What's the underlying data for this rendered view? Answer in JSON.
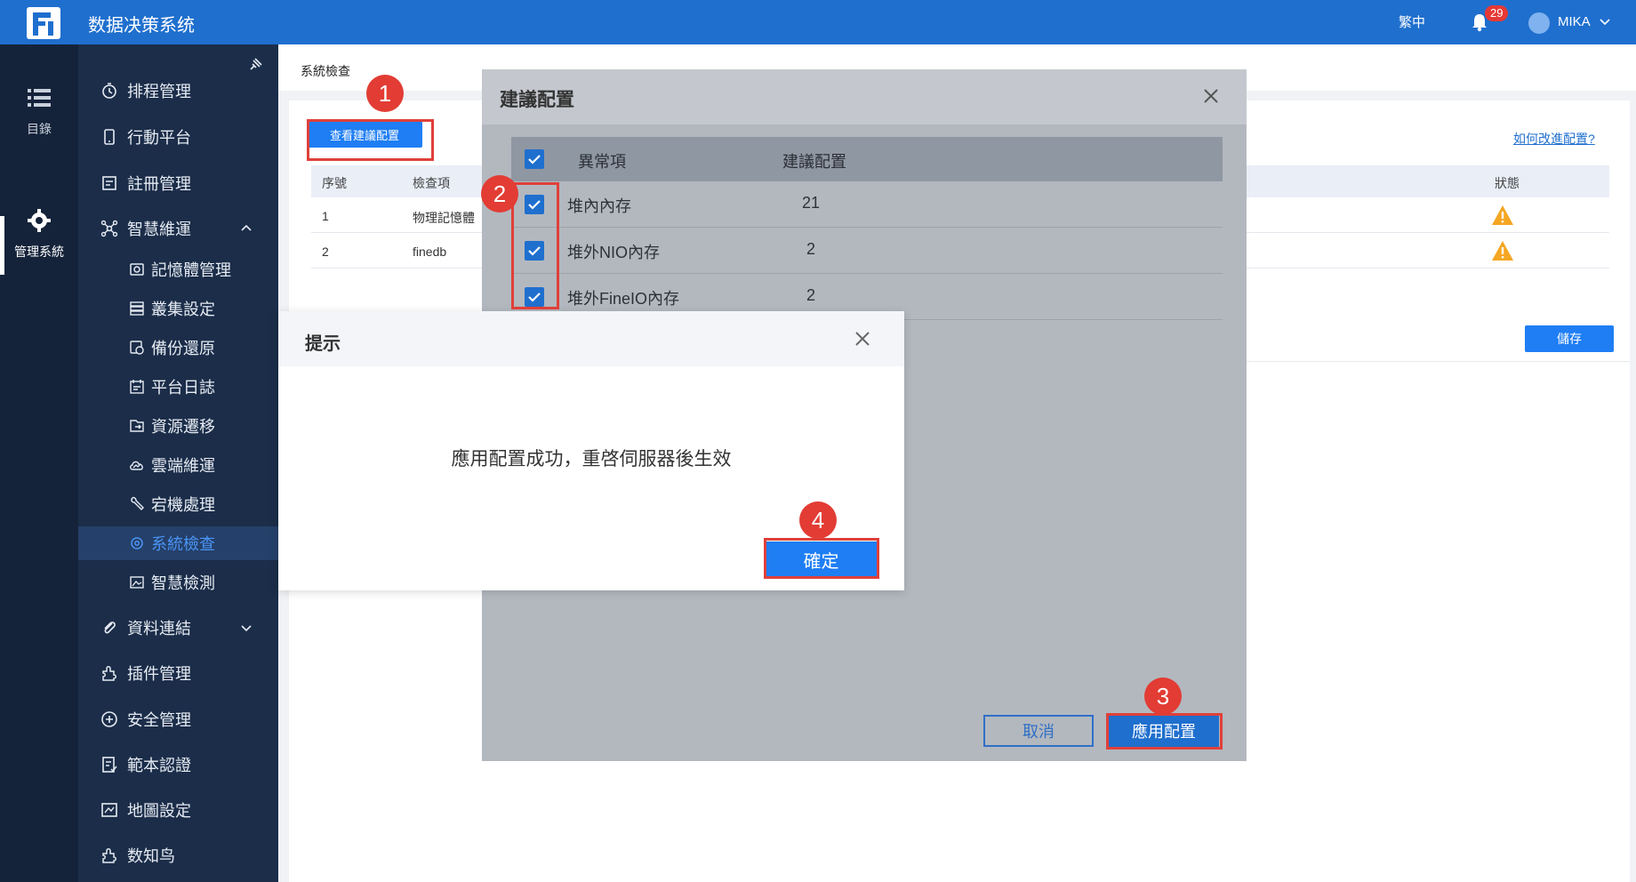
{
  "app": {
    "title": "数据决策系统",
    "lang": "繁中",
    "notifications": "29",
    "user": "MIKA"
  },
  "rail": {
    "items": [
      {
        "label": "目錄",
        "icon": "list-icon"
      },
      {
        "label": "管理系統",
        "icon": "gear-icon"
      }
    ]
  },
  "sidebar": {
    "items": [
      {
        "label": "排程管理",
        "icon": "timer-icon"
      },
      {
        "label": "行動平台",
        "icon": "mobile-icon"
      },
      {
        "label": "註冊管理",
        "icon": "register-icon"
      },
      {
        "label": "智慧維運",
        "icon": "network-icon"
      },
      {
        "label": "記憶體管理",
        "icon": "memory-icon"
      },
      {
        "label": "叢集設定",
        "icon": "cluster-icon"
      },
      {
        "label": "備份還原",
        "icon": "backup-icon"
      },
      {
        "label": "平台日誌",
        "icon": "log-icon"
      },
      {
        "label": "資源遷移",
        "icon": "migrate-icon"
      },
      {
        "label": "雲端維運",
        "icon": "cloud-icon"
      },
      {
        "label": "宕機處理",
        "icon": "wrench-icon"
      },
      {
        "label": "系統檢查",
        "icon": "gear-check-icon"
      },
      {
        "label": "智慧檢測",
        "icon": "image-check-icon"
      },
      {
        "label": "資料連結",
        "icon": "link-icon"
      },
      {
        "label": "插件管理",
        "icon": "plugin-icon"
      },
      {
        "label": "安全管理",
        "icon": "shield-icon"
      },
      {
        "label": "範本認證",
        "icon": "template-icon"
      },
      {
        "label": "地圖設定",
        "icon": "map-icon"
      },
      {
        "label": "数知鸟",
        "icon": "plugin-icon"
      }
    ]
  },
  "main": {
    "breadcrumb": "系統檢查",
    "view_button": "查看建議配置",
    "how_link": "如何改進配置?",
    "table": {
      "headers": [
        "序號",
        "檢查項",
        "狀態"
      ],
      "rows": [
        {
          "index": "1",
          "item": "物理記憶體"
        },
        {
          "index": "2",
          "item": "finedb"
        }
      ]
    },
    "save_button": "儲存"
  },
  "suggest_dialog": {
    "title": "建議配置",
    "headers": [
      "異常項",
      "建議配置"
    ],
    "rows": [
      {
        "item": "堆內內存",
        "value": "21"
      },
      {
        "item": "堆外NIO內存",
        "value": "2"
      },
      {
        "item": "堆外FineIO內存",
        "value": "2"
      }
    ],
    "cancel": "取消",
    "apply": "應用配置"
  },
  "prompt_dialog": {
    "title": "提示",
    "message": "應用配置成功，重啓伺服器後生效",
    "ok": "確定"
  },
  "annotations": [
    "1",
    "2",
    "3",
    "4"
  ],
  "colors": {
    "brand": "#1f6fce",
    "button": "#1f7ef4",
    "sidebar": "#1b2d49",
    "rail": "#15233a",
    "highlight": "#e0403a",
    "warning": "#f5a623"
  }
}
